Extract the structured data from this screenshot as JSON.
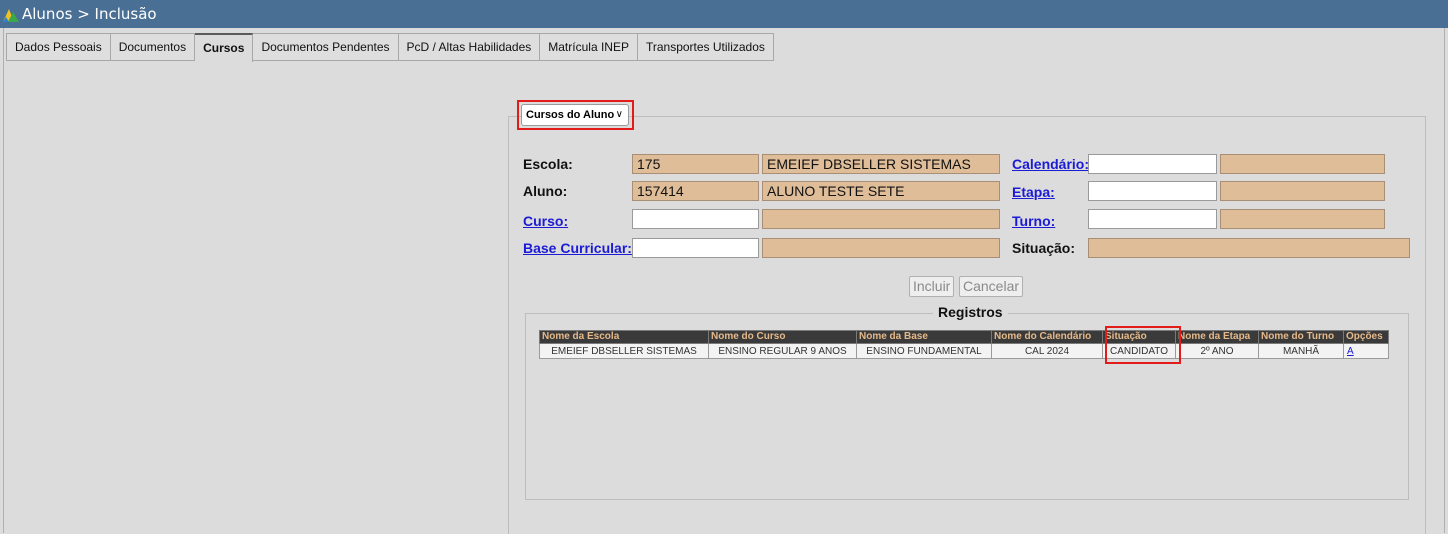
{
  "window": {
    "title": "Alunos > Inclusão"
  },
  "tabs": [
    {
      "label": "Dados Pessoais",
      "active": false
    },
    {
      "label": "Documentos",
      "active": false
    },
    {
      "label": "Cursos",
      "active": true
    },
    {
      "label": "Documentos Pendentes",
      "active": false
    },
    {
      "label": "PcD / Altas Habilidades",
      "active": false
    },
    {
      "label": "Matrícula INEP",
      "active": false
    },
    {
      "label": "Transportes Utilizados",
      "active": false
    }
  ],
  "section_select": {
    "value": "Cursos do Aluno"
  },
  "form": {
    "escola": {
      "label": "Escola:",
      "code": "175",
      "name": "EMEIEF DBSELLER SISTEMAS"
    },
    "aluno": {
      "label": "Aluno:",
      "code": "157414",
      "name": "ALUNO TESTE SETE"
    },
    "curso": {
      "label": "Curso:",
      "code": "",
      "name": ""
    },
    "base_curricular": {
      "label": "Base Curricular:",
      "code": "",
      "name": ""
    },
    "calendario": {
      "label": "Calendário:",
      "code": "",
      "name": ""
    },
    "etapa": {
      "label": "Etapa:",
      "code": "",
      "name": ""
    },
    "turno": {
      "label": "Turno:",
      "code": "",
      "name": ""
    },
    "situacao": {
      "label": "Situação:",
      "value": ""
    }
  },
  "buttons": {
    "incluir": "Incluir",
    "cancelar": "Cancelar"
  },
  "registros": {
    "title": "Registros",
    "columns": [
      "Nome da Escola",
      "Nome do Curso",
      "Nome da Base",
      "Nome do Calendário",
      "Situação",
      "Nome da Etapa",
      "Nome do Turno",
      "Opções"
    ],
    "rows": [
      [
        "EMEIEF DBSELLER SISTEMAS",
        "ENSINO REGULAR 9 ANOS",
        "ENSINO FUNDAMENTAL",
        "CAL 2024",
        "CANDIDATO",
        "2º ANO",
        "MANHÃ",
        "A"
      ]
    ]
  },
  "colors": {
    "titlebar": "#4a6f94",
    "readonly_field": "#dfbd99",
    "highlight": "#e41b1b",
    "table_header": "#3a3a3a",
    "table_header_text": "#e6b98a"
  }
}
